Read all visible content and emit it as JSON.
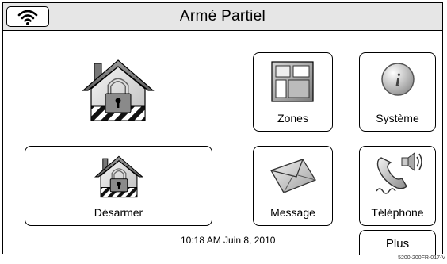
{
  "header": {
    "title": "Armé Partiel"
  },
  "buttons": {
    "desarmer": "Désarmer",
    "zones": "Zones",
    "systeme": "Système",
    "message": "Message",
    "telephone": "Téléphone",
    "plus": "Plus"
  },
  "status": {
    "datetime": "10:18 AM Juin 8, 2010"
  },
  "footer": {
    "code": "5200-200FR-017-V"
  },
  "icons": {
    "wifi": "wifi-icon",
    "armed_house": "armed-house-lock-icon",
    "disarm": "house-lock-icon",
    "zones": "zones-grid-icon",
    "system": "info-icon",
    "message": "envelope-icon",
    "telephone": "phone-icon"
  }
}
